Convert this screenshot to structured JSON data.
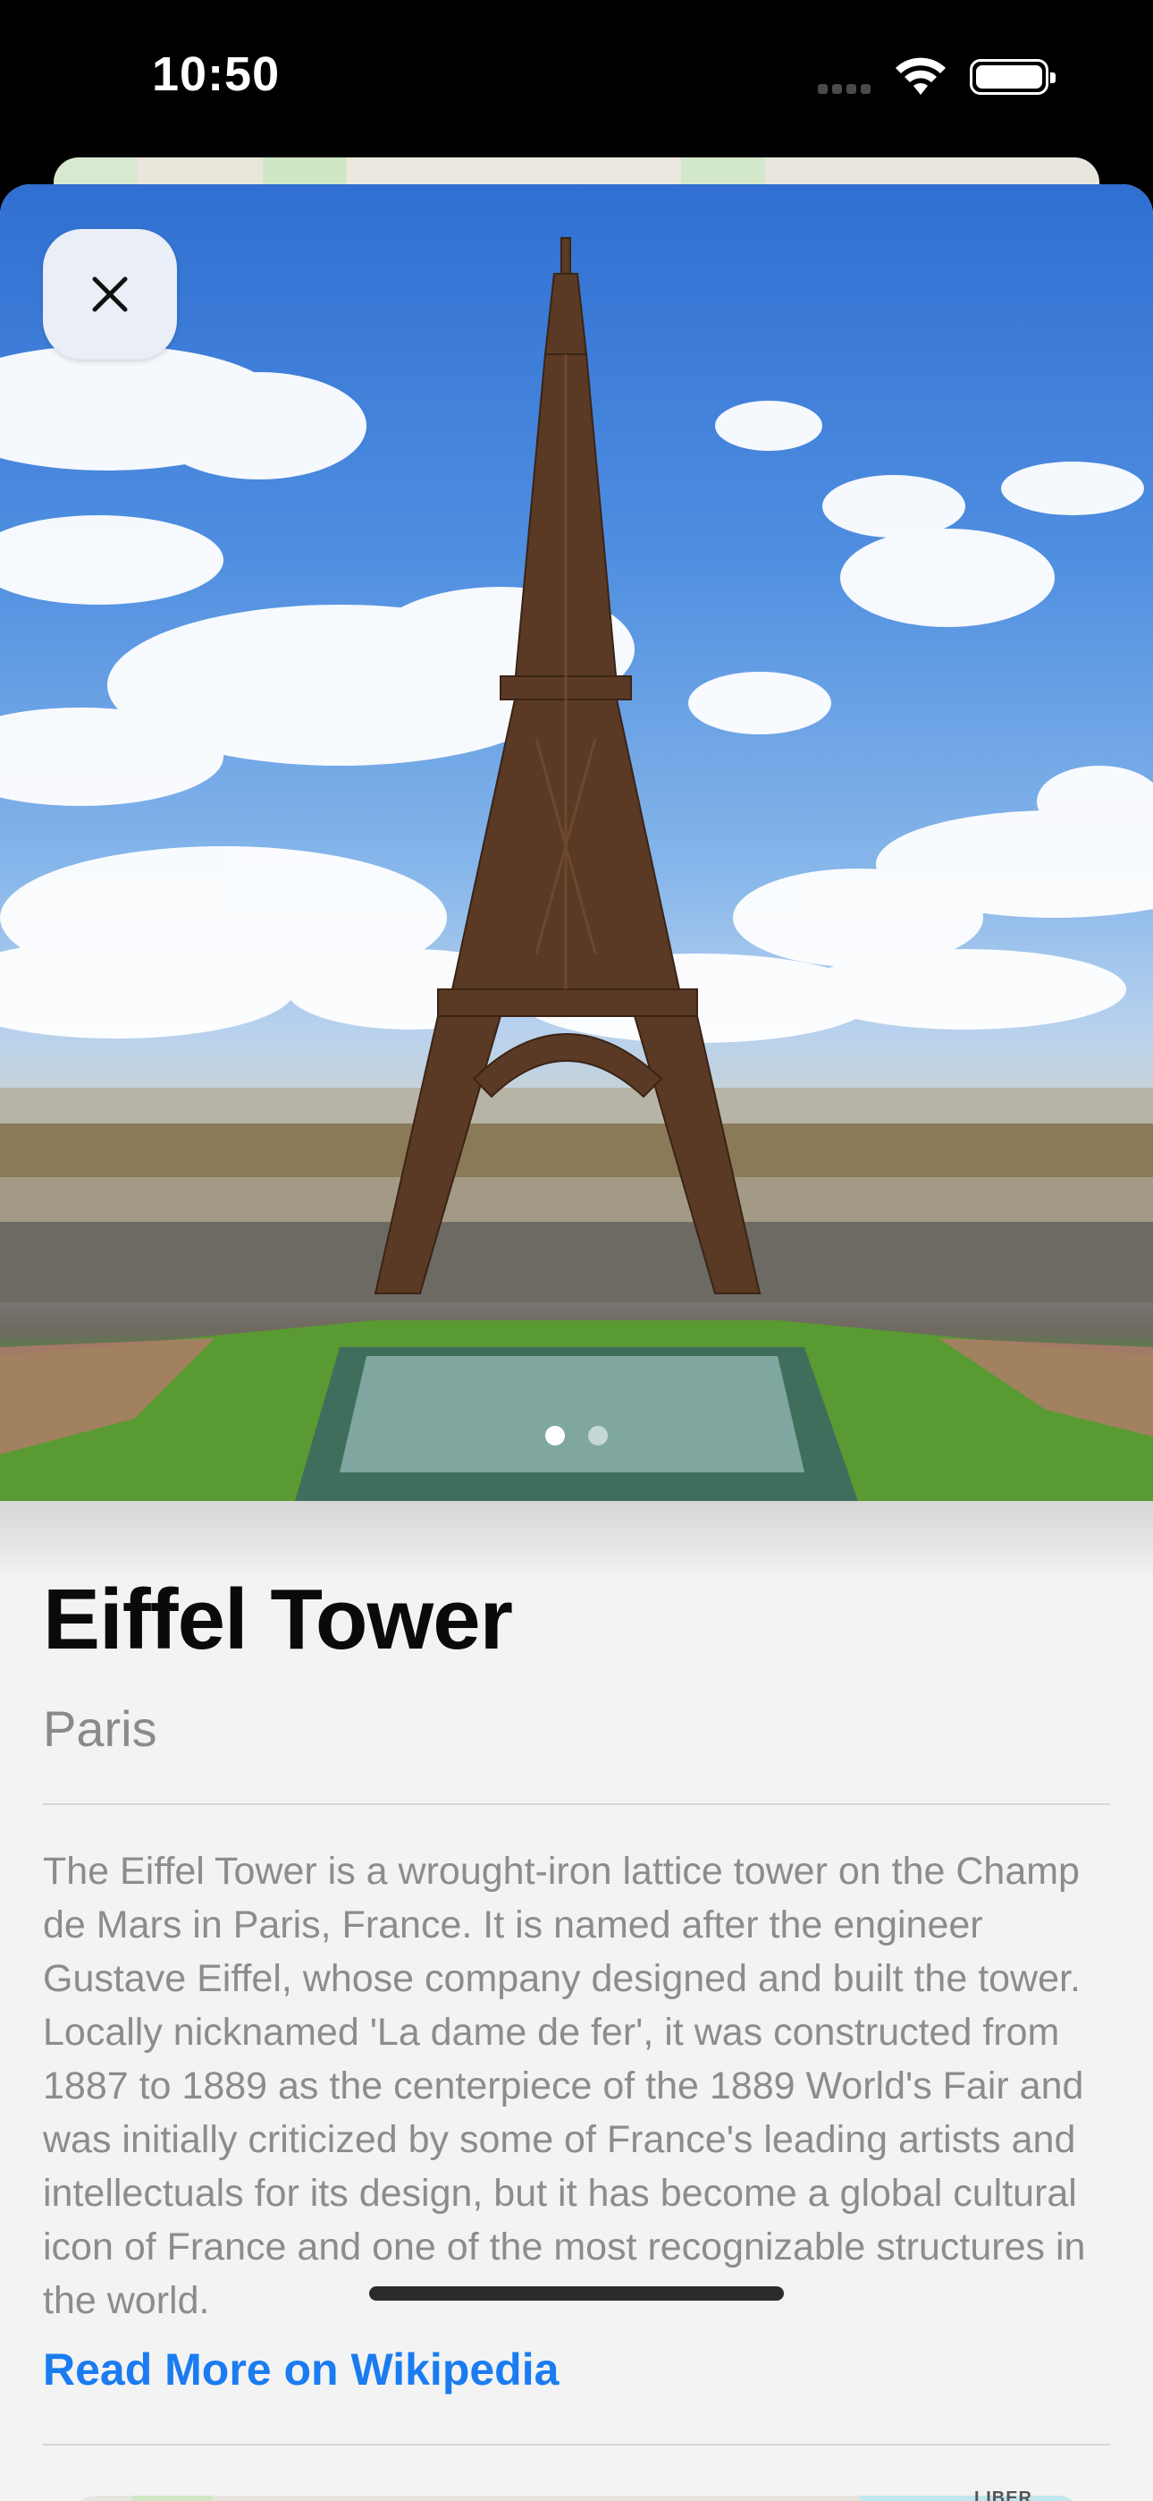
{
  "status_bar": {
    "time": "10:50"
  },
  "place": {
    "title": "Eiffel Tower",
    "city": "Paris",
    "description": "The Eiffel Tower is a wrought-iron lattice tower on the Champ de Mars in Paris, France. It is named after the engineer Gustave Eiffel, whose company designed and built the tower. Locally nicknamed 'La dame de fer', it was constructed from 1887 to 1889 as the centerpiece of the 1889 World's Fair and was initially criticized by some of France's leading artists and intellectuals for its design, but it has become a global cultural icon of France and one of the most recognizable structures in the world.",
    "link_label": "Read More on Wikipedia"
  },
  "gallery": {
    "page_count": 2,
    "current_page": 1
  },
  "map": {
    "corner_label": "LIBER"
  },
  "icons": {
    "close": "close-icon",
    "wifi": "wifi-icon",
    "battery": "battery-icon",
    "signal": "cellular-signal-icon"
  },
  "colors": {
    "link": "#1a7cf0",
    "sheet_background": "#f3f3f3",
    "title": "#0a0a0a",
    "secondary_text": "#8a8a8a"
  }
}
